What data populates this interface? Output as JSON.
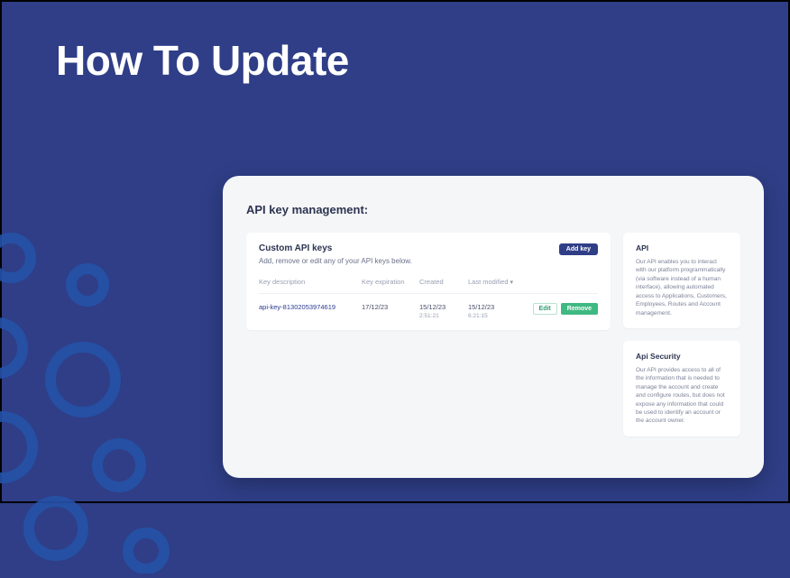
{
  "slide": {
    "title": "How To Update"
  },
  "panel": {
    "heading": "API key management:"
  },
  "keys_card": {
    "title": "Custom API keys",
    "subtitle": "Add, remove or edit any of your API keys below.",
    "add_label": "Add key",
    "columns": {
      "desc": "Key description",
      "exp": "Key expiration",
      "created": "Created",
      "modified": "Last modified"
    },
    "row": {
      "desc": "api-key-81302053974619",
      "exp": "17/12/23",
      "created": "15/12/23",
      "created_time": "2:51:21",
      "modified": "15/12/23",
      "modified_time": "6:21:15",
      "edit_label": "Edit",
      "remove_label": "Remove"
    }
  },
  "info_api": {
    "title": "API",
    "text": "Our API enables you to interact with our platform programmatically (via software instead of a human interface), allowing automated access to Applications, Customers, Employees, Routes and Account management."
  },
  "info_security": {
    "title": "Api Security",
    "text": "Our API provides access to all of the information that is needed to manage the account and create and configure routes, but does not expose any information that could be used to identify an account or the account owner."
  }
}
